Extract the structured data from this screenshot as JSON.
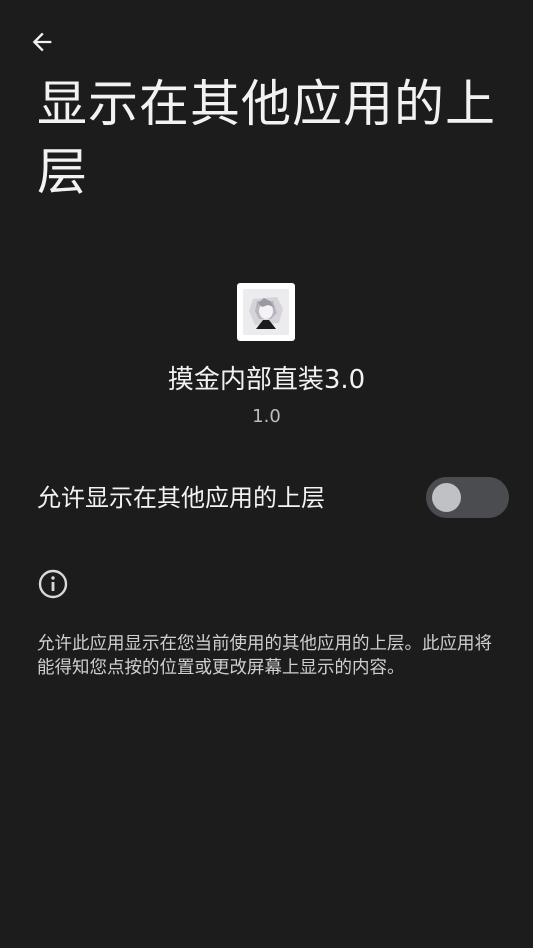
{
  "header": {
    "title": "显示在其他应用的上层"
  },
  "app": {
    "name": "摸金内部直装3.0",
    "version": "1.0"
  },
  "setting": {
    "label": "允许显示在其他应用的上层",
    "enabled": false
  },
  "info": {
    "description": "允许此应用显示在您当前使用的其他应用的上层。此应用将能得知您点按的位置或更改屏幕上显示的内容。"
  },
  "colors": {
    "background": "#1c1c1c",
    "switch_track": "#4a4c50",
    "switch_thumb": "#bfc1c4"
  },
  "icons": {
    "back": "arrow-back-icon",
    "info": "info-icon",
    "app": "app-icon"
  }
}
